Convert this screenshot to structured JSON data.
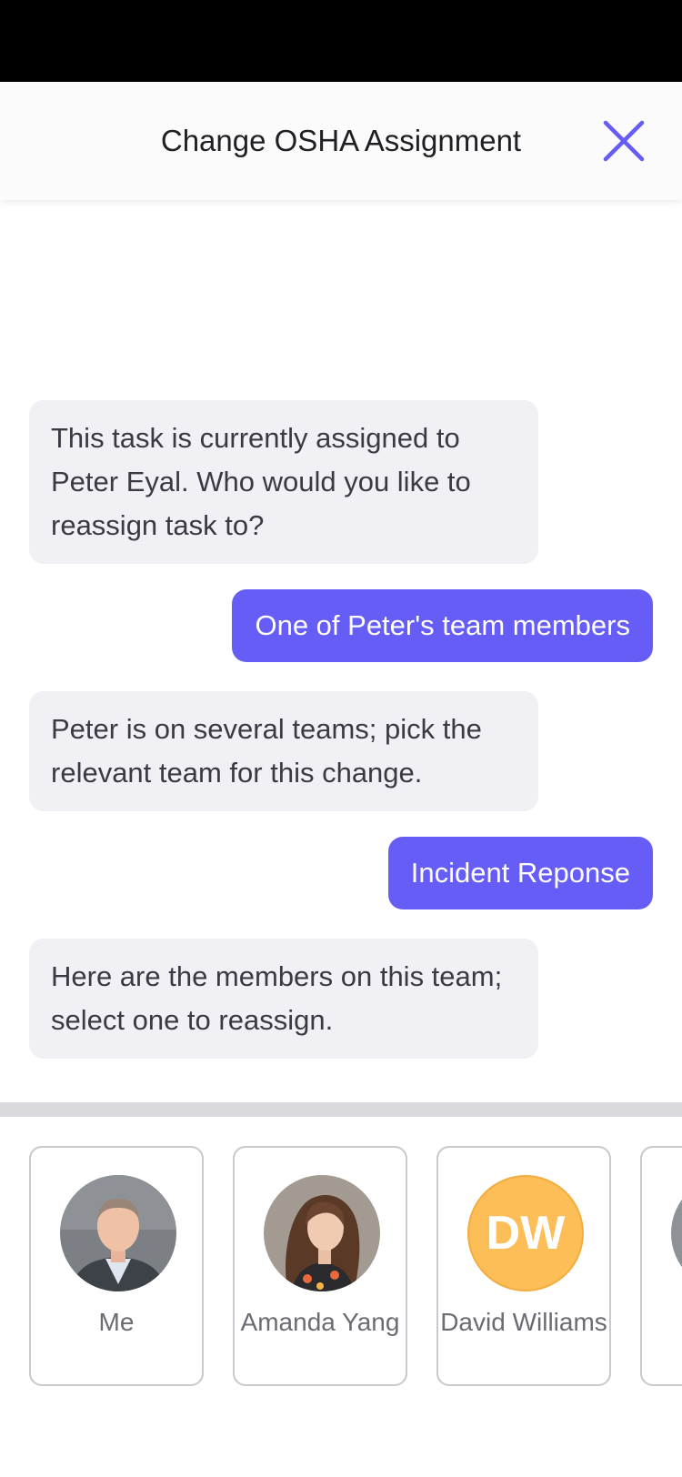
{
  "header": {
    "title": "Change OSHA Assignment",
    "close_icon": "close-icon",
    "accent_color": "#665cf6"
  },
  "messages": [
    {
      "from": "bot",
      "text": "This task is currently assigned to Peter Eyal. Who would you like to reassign task to?"
    },
    {
      "from": "user",
      "text": "One of Peter's team members"
    },
    {
      "from": "bot",
      "text": "Peter is on several teams; pick the relevant team for this change."
    },
    {
      "from": "user",
      "text": "Incident Reponse"
    },
    {
      "from": "bot",
      "text": "Here are the members on this team; select one to reassign."
    }
  ],
  "members": [
    {
      "name": "Me",
      "avatar": "photo"
    },
    {
      "name": "Amanda Yang",
      "avatar": "photo"
    },
    {
      "name": "David Williams",
      "initials": "DW",
      "avatar_color": "#fdbd57"
    }
  ]
}
